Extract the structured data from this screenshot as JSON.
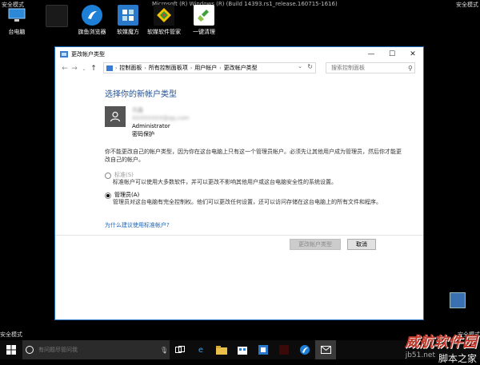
{
  "desktop": {
    "safe_mode_top_left": "安全模式",
    "safe_mode_top_right": "安全模式",
    "safe_mode_bottom_left": "安全模式",
    "safe_mode_bottom_right": "安全模式",
    "build_text": "Microsoft (R) Windows (R) (Build 14393.rs1_release.160715-1616)",
    "icons": [
      {
        "label": "台电脑",
        "icon": "computer-icon"
      },
      {
        "label": "旗鱼浏览器",
        "icon": "browser-icon"
      },
      {
        "label": "软媒魔方",
        "icon": "rubik-cube-icon"
      },
      {
        "label": "软媒软件管家",
        "icon": "software-manager-icon"
      },
      {
        "label": "一键清理",
        "icon": "broom-icon"
      }
    ]
  },
  "window": {
    "title": "更改帐户类型",
    "controls": {
      "minimize": "—",
      "maximize": "☐",
      "close": "✕"
    },
    "breadcrumb": [
      "控制面板",
      "所有控制面板项",
      "用户帐户",
      "更改帐户类型"
    ],
    "search_placeholder": "搜索控制面板",
    "heading": "选择你的新帐户类型",
    "account": {
      "name": "讯鑫",
      "email": "XXXXXXXX@qq.com",
      "role": "Administrator",
      "protection": "密码保护"
    },
    "description": "你不能更改自己的帐户类型，因为你在这台电脑上只有这一个管理员帐户。必须先让其他用户成为管理员，然后你才能更改自己的帐户。",
    "options": [
      {
        "label": "标准(S)",
        "desc": "标准帐户可以使用大多数软件，并可以更改不影响其他用户或这台电脑安全性的系统设置。",
        "selected": false,
        "disabled": true
      },
      {
        "label": "管理员(A)",
        "desc": "管理员对这台电脑有完全控制权。他们可以更改任何设置，还可以访问存储在这台电脑上的所有文件和程序。",
        "selected": true,
        "disabled": false
      }
    ],
    "help_link": "为什么建议使用标准帐户?",
    "buttons": {
      "change": "更改帐户类型",
      "cancel": "取消"
    }
  },
  "taskbar": {
    "search_placeholder": "有问题尽管问我",
    "icons": [
      "task-view-icon",
      "edge-icon",
      "file-explorer-icon",
      "store-icon",
      "softmedia-icon",
      "photoshop-icon",
      "browser-icon",
      "mail-icon"
    ]
  },
  "watermark": {
    "logo_text": "威航软件园",
    "site_text": "jb51.net",
    "site_text2": "脚本之家"
  },
  "colors": {
    "accent": "#1e4f97",
    "link": "#1a5fb4",
    "window_border": "#1f6fc5"
  }
}
